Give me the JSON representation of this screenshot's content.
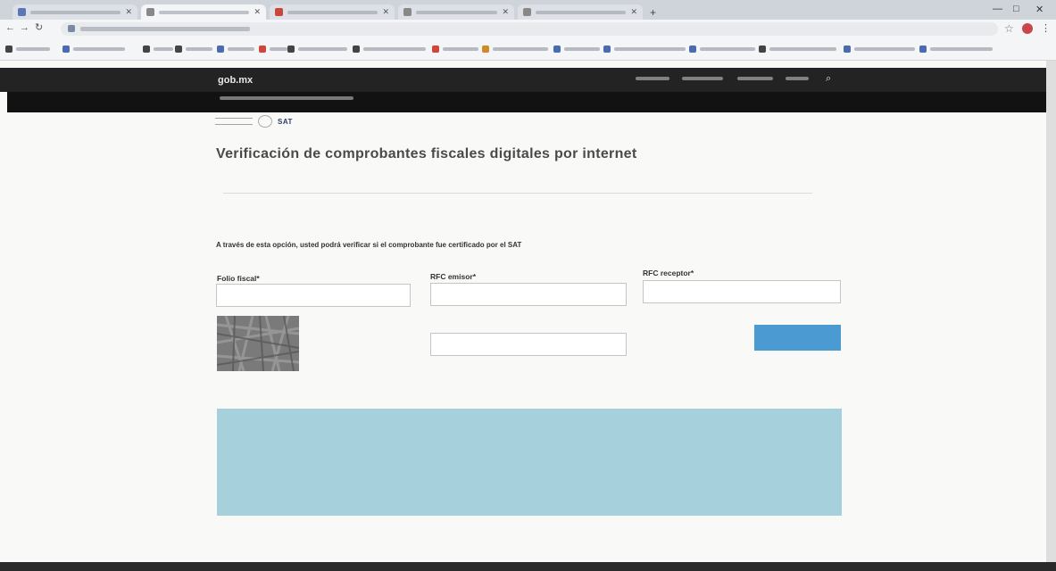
{
  "browser": {
    "tabs": [
      {
        "title": "",
        "active": false
      },
      {
        "title": "",
        "active": true
      },
      {
        "title": "",
        "active": false
      },
      {
        "title": "",
        "active": false
      },
      {
        "title": "",
        "active": false
      }
    ],
    "url": "",
    "bookmarks": [
      "",
      "",
      "",
      "",
      "",
      "",
      "",
      "",
      "",
      "",
      "",
      "",
      "",
      "",
      "",
      ""
    ]
  },
  "site": {
    "logo": "gob.mx",
    "nav": [
      "",
      "",
      "",
      ""
    ],
    "section_title": ""
  },
  "page": {
    "title": "Verificación de comprobantes fiscales digitales por internet",
    "intro": "A través de esta opción, usted podrá verificar si el comprobante fue certificado por el SAT"
  },
  "form": {
    "folio_label": "Folio fiscal*",
    "folio_value": "",
    "rfc_emisor_label": "RFC emisor*",
    "rfc_emisor_value": "",
    "rfc_receptor_label": "RFC receptor*",
    "rfc_receptor_value": "",
    "captcha_label": "",
    "captcha_value": "",
    "verify_label": "",
    "required_note": ""
  },
  "notice": {
    "line1": "",
    "line2_text": "",
    "link_text": ""
  },
  "colors": {
    "header_dark": "#232323",
    "subheader_dark": "#121212",
    "button_blue": "#4c9ad2",
    "notice_bg": "#a7d0dd"
  }
}
